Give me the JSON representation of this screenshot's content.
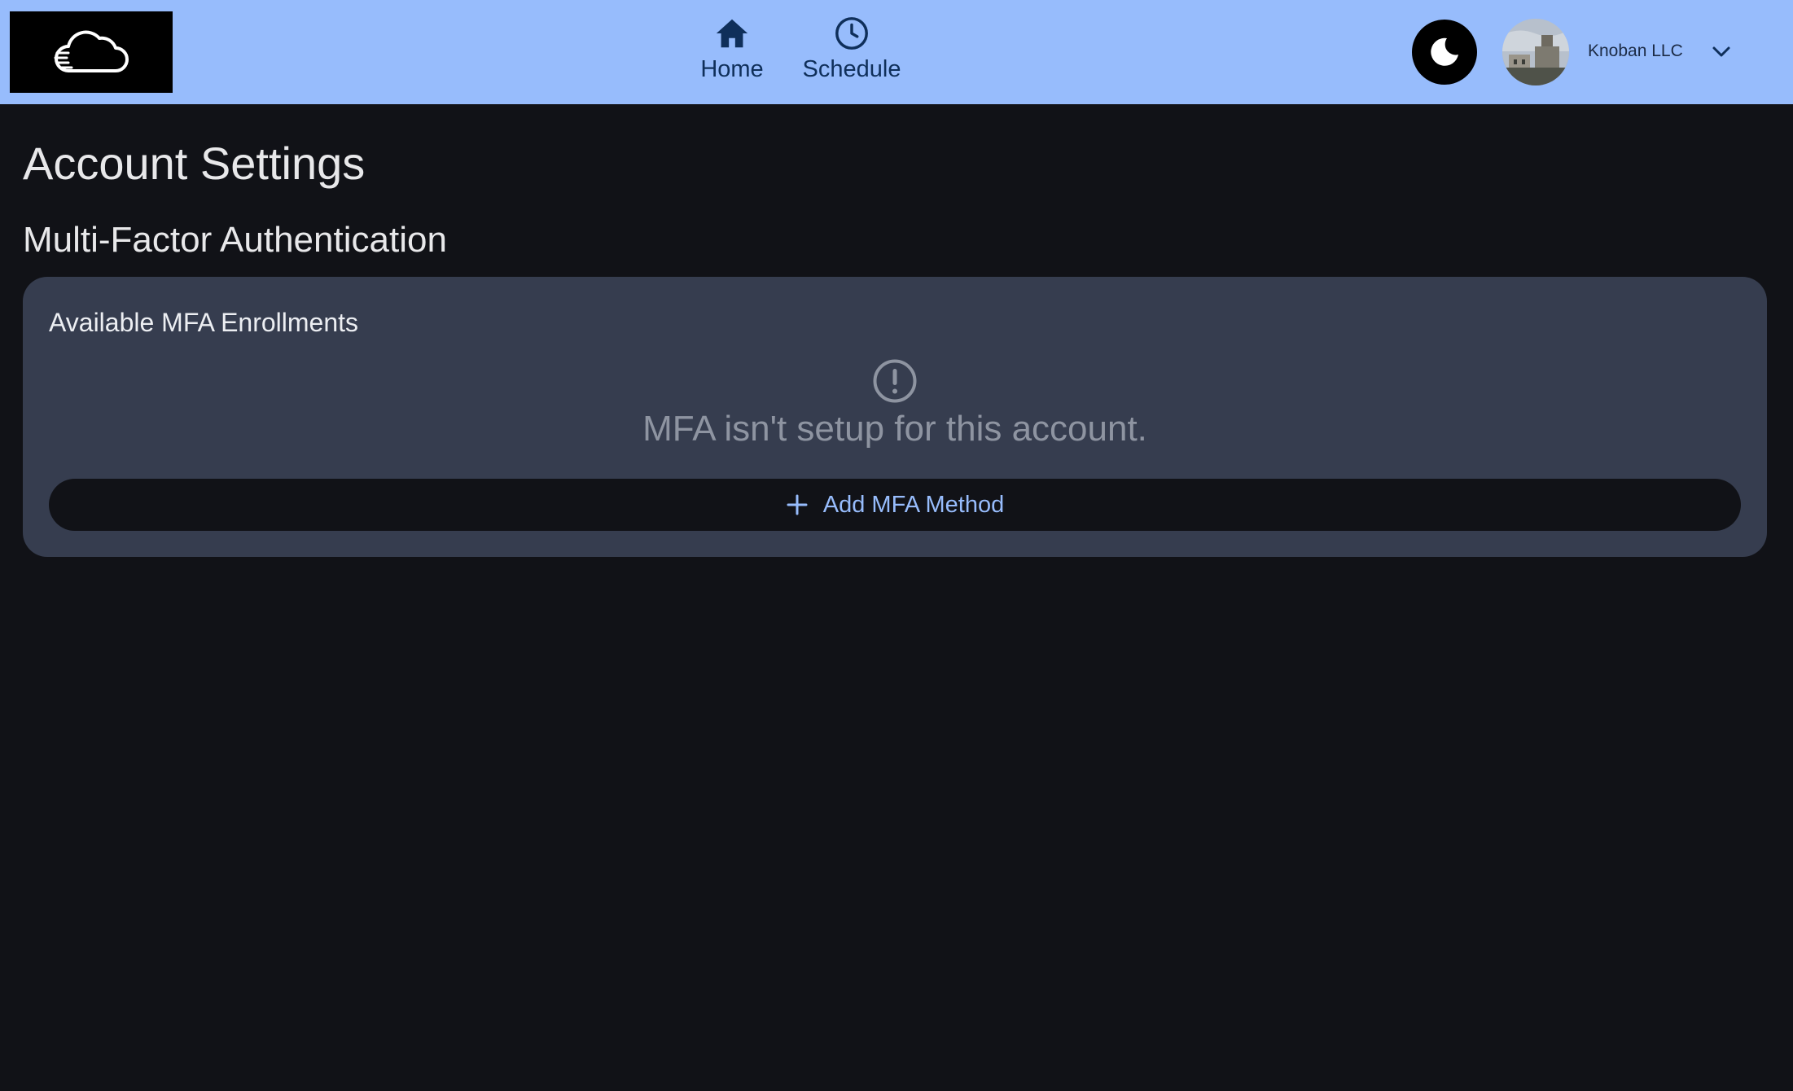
{
  "header": {
    "nav": [
      {
        "label": "Home",
        "icon": "home-icon"
      },
      {
        "label": "Schedule",
        "icon": "clock-icon"
      }
    ],
    "theme_toggle_icon": "moon-icon",
    "user": {
      "name": "Knoban LLC"
    }
  },
  "main": {
    "title": "Account Settings",
    "mfa_section": {
      "title": "Multi-Factor Authentication",
      "card_title": "Available MFA Enrollments",
      "empty_message": "MFA isn't setup for this account.",
      "add_button_label": "Add MFA Method"
    }
  },
  "colors": {
    "header_bg": "#97bcfc",
    "page_bg": "#111217",
    "card_bg": "#363d4f",
    "accent": "#97bcfc",
    "muted_text": "#8e94a1"
  }
}
